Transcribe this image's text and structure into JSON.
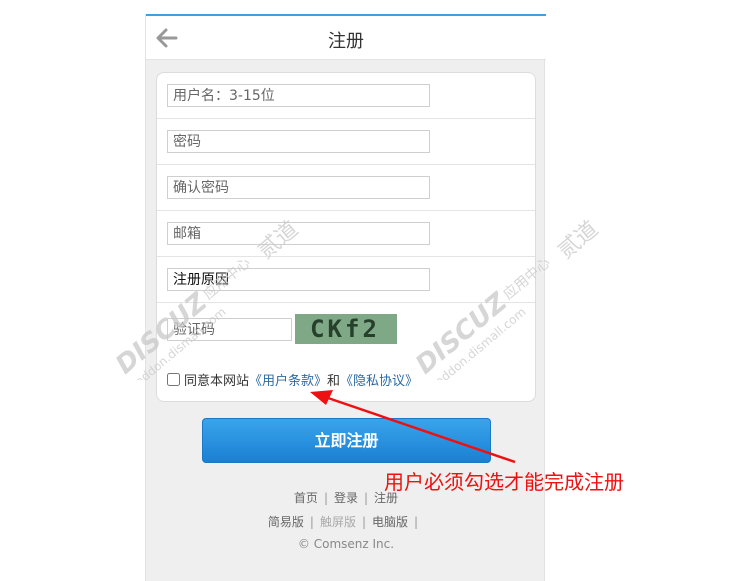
{
  "header": {
    "title": "注册"
  },
  "form": {
    "username_placeholder": "用户名：3-15位",
    "password_placeholder": "密码",
    "confirm_password_placeholder": "确认密码",
    "email_placeholder": "邮箱",
    "reason_placeholder": "注册原因",
    "captcha_placeholder": "验证码",
    "captcha_text": "CKf2",
    "agree_prefix": "同意本网站",
    "terms_link": "《用户条款》",
    "agree_and": "和",
    "privacy_link": "《隐私协议》",
    "submit_label": "立即注册"
  },
  "footer": {
    "links_row1": [
      "首页",
      "登录",
      "注册"
    ],
    "links_row2": [
      "简易版",
      "触屏版",
      "电脑版"
    ],
    "copyright": "© Comsenz Inc."
  },
  "watermark": {
    "brand": "DISCUZ",
    "cn_text": "应用中心",
    "sub": "addon.dismall.com",
    "mark": "贰道"
  },
  "annotation": {
    "text": "用户必须勾选才能完成注册",
    "color": "#ee1111"
  },
  "colors": {
    "accent": "#1a80d4",
    "link": "#2b6aa5",
    "top_border": "#3aa2e0"
  }
}
